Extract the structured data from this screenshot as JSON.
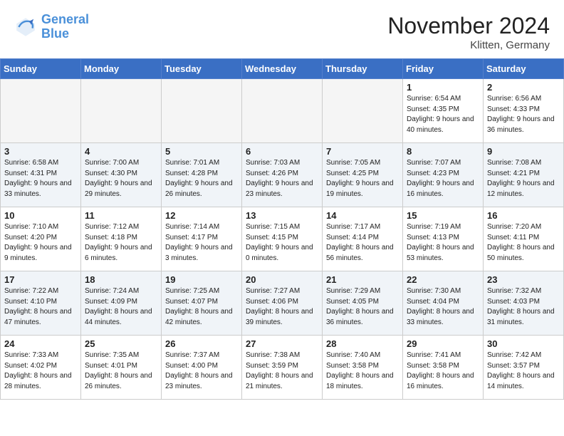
{
  "header": {
    "logo_line1": "General",
    "logo_line2": "Blue",
    "month_title": "November 2024",
    "location": "Klitten, Germany"
  },
  "weekdays": [
    "Sunday",
    "Monday",
    "Tuesday",
    "Wednesday",
    "Thursday",
    "Friday",
    "Saturday"
  ],
  "weeks": [
    [
      {
        "day": "",
        "info": ""
      },
      {
        "day": "",
        "info": ""
      },
      {
        "day": "",
        "info": ""
      },
      {
        "day": "",
        "info": ""
      },
      {
        "day": "",
        "info": ""
      },
      {
        "day": "1",
        "info": "Sunrise: 6:54 AM\nSunset: 4:35 PM\nDaylight: 9 hours\nand 40 minutes."
      },
      {
        "day": "2",
        "info": "Sunrise: 6:56 AM\nSunset: 4:33 PM\nDaylight: 9 hours\nand 36 minutes."
      }
    ],
    [
      {
        "day": "3",
        "info": "Sunrise: 6:58 AM\nSunset: 4:31 PM\nDaylight: 9 hours\nand 33 minutes."
      },
      {
        "day": "4",
        "info": "Sunrise: 7:00 AM\nSunset: 4:30 PM\nDaylight: 9 hours\nand 29 minutes."
      },
      {
        "day": "5",
        "info": "Sunrise: 7:01 AM\nSunset: 4:28 PM\nDaylight: 9 hours\nand 26 minutes."
      },
      {
        "day": "6",
        "info": "Sunrise: 7:03 AM\nSunset: 4:26 PM\nDaylight: 9 hours\nand 23 minutes."
      },
      {
        "day": "7",
        "info": "Sunrise: 7:05 AM\nSunset: 4:25 PM\nDaylight: 9 hours\nand 19 minutes."
      },
      {
        "day": "8",
        "info": "Sunrise: 7:07 AM\nSunset: 4:23 PM\nDaylight: 9 hours\nand 16 minutes."
      },
      {
        "day": "9",
        "info": "Sunrise: 7:08 AM\nSunset: 4:21 PM\nDaylight: 9 hours\nand 12 minutes."
      }
    ],
    [
      {
        "day": "10",
        "info": "Sunrise: 7:10 AM\nSunset: 4:20 PM\nDaylight: 9 hours\nand 9 minutes."
      },
      {
        "day": "11",
        "info": "Sunrise: 7:12 AM\nSunset: 4:18 PM\nDaylight: 9 hours\nand 6 minutes."
      },
      {
        "day": "12",
        "info": "Sunrise: 7:14 AM\nSunset: 4:17 PM\nDaylight: 9 hours\nand 3 minutes."
      },
      {
        "day": "13",
        "info": "Sunrise: 7:15 AM\nSunset: 4:15 PM\nDaylight: 9 hours\nand 0 minutes."
      },
      {
        "day": "14",
        "info": "Sunrise: 7:17 AM\nSunset: 4:14 PM\nDaylight: 8 hours\nand 56 minutes."
      },
      {
        "day": "15",
        "info": "Sunrise: 7:19 AM\nSunset: 4:13 PM\nDaylight: 8 hours\nand 53 minutes."
      },
      {
        "day": "16",
        "info": "Sunrise: 7:20 AM\nSunset: 4:11 PM\nDaylight: 8 hours\nand 50 minutes."
      }
    ],
    [
      {
        "day": "17",
        "info": "Sunrise: 7:22 AM\nSunset: 4:10 PM\nDaylight: 8 hours\nand 47 minutes."
      },
      {
        "day": "18",
        "info": "Sunrise: 7:24 AM\nSunset: 4:09 PM\nDaylight: 8 hours\nand 44 minutes."
      },
      {
        "day": "19",
        "info": "Sunrise: 7:25 AM\nSunset: 4:07 PM\nDaylight: 8 hours\nand 42 minutes."
      },
      {
        "day": "20",
        "info": "Sunrise: 7:27 AM\nSunset: 4:06 PM\nDaylight: 8 hours\nand 39 minutes."
      },
      {
        "day": "21",
        "info": "Sunrise: 7:29 AM\nSunset: 4:05 PM\nDaylight: 8 hours\nand 36 minutes."
      },
      {
        "day": "22",
        "info": "Sunrise: 7:30 AM\nSunset: 4:04 PM\nDaylight: 8 hours\nand 33 minutes."
      },
      {
        "day": "23",
        "info": "Sunrise: 7:32 AM\nSunset: 4:03 PM\nDaylight: 8 hours\nand 31 minutes."
      }
    ],
    [
      {
        "day": "24",
        "info": "Sunrise: 7:33 AM\nSunset: 4:02 PM\nDaylight: 8 hours\nand 28 minutes."
      },
      {
        "day": "25",
        "info": "Sunrise: 7:35 AM\nSunset: 4:01 PM\nDaylight: 8 hours\nand 26 minutes."
      },
      {
        "day": "26",
        "info": "Sunrise: 7:37 AM\nSunset: 4:00 PM\nDaylight: 8 hours\nand 23 minutes."
      },
      {
        "day": "27",
        "info": "Sunrise: 7:38 AM\nSunset: 3:59 PM\nDaylight: 8 hours\nand 21 minutes."
      },
      {
        "day": "28",
        "info": "Sunrise: 7:40 AM\nSunset: 3:58 PM\nDaylight: 8 hours\nand 18 minutes."
      },
      {
        "day": "29",
        "info": "Sunrise: 7:41 AM\nSunset: 3:58 PM\nDaylight: 8 hours\nand 16 minutes."
      },
      {
        "day": "30",
        "info": "Sunrise: 7:42 AM\nSunset: 3:57 PM\nDaylight: 8 hours\nand 14 minutes."
      }
    ]
  ]
}
